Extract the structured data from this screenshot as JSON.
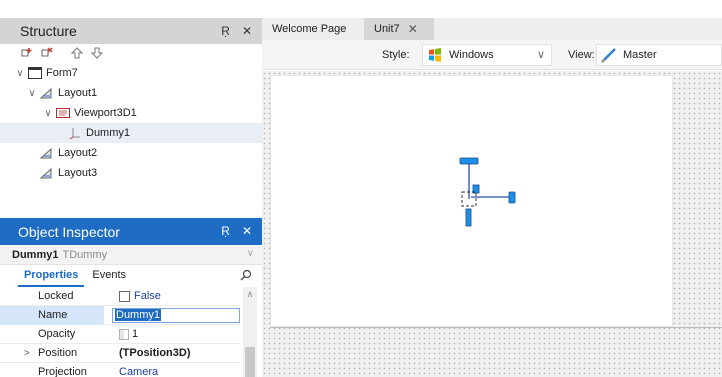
{
  "structure": {
    "title": "Structure",
    "pin_glyph": "Ṛ",
    "close_glyph": "✕",
    "toolbar": [
      "add-item-icon",
      "remove-item-icon",
      "move-up-icon",
      "move-down-icon"
    ],
    "tree": [
      {
        "label": "Form7",
        "icon": "form-icon",
        "expanded": true,
        "selected": false
      },
      {
        "label": "Layout1",
        "icon": "layout-icon",
        "expanded": true,
        "selected": false
      },
      {
        "label": "Viewport3D1",
        "icon": "viewport-icon",
        "expanded": true,
        "selected": false
      },
      {
        "label": "Dummy1",
        "icon": "dummy-icon",
        "expanded": false,
        "selected": true
      },
      {
        "label": "Layout2",
        "icon": "layout-icon",
        "expanded": false,
        "selected": false
      },
      {
        "label": "Layout3",
        "icon": "layout-icon",
        "expanded": false,
        "selected": false
      }
    ]
  },
  "inspector": {
    "title": "Object Inspector",
    "object_name": "Dummy1",
    "object_type": "TDummy",
    "tabs": [
      "Properties",
      "Events"
    ],
    "active_tab": "Properties",
    "properties": [
      {
        "name": "Locked",
        "value": "False",
        "kind": "checkbox",
        "selected": false,
        "expandable": false
      },
      {
        "name": "Name",
        "value": "Dummy1",
        "kind": "editor",
        "selected": true,
        "expandable": false
      },
      {
        "name": "Opacity",
        "value": "1",
        "kind": "opacity",
        "selected": false,
        "expandable": false
      },
      {
        "name": "Position",
        "value": "(TPosition3D)",
        "kind": "bold",
        "selected": false,
        "expandable": true
      },
      {
        "name": "Projection",
        "value": "Camera",
        "kind": "plain",
        "selected": false,
        "expandable": false
      }
    ]
  },
  "designer": {
    "tabs": [
      {
        "label": "Welcome Page",
        "active": false,
        "closable": false
      },
      {
        "label": "Unit7",
        "active": true,
        "closable": true
      }
    ],
    "style_label": "Style:",
    "style_value": "Windows",
    "view_label": "View:",
    "view_value": "Master"
  },
  "colors": {
    "accent": "#1e6cc4",
    "gizmo_line": "#2b4fa8",
    "gizmo_fill": "#1e8fe6"
  }
}
